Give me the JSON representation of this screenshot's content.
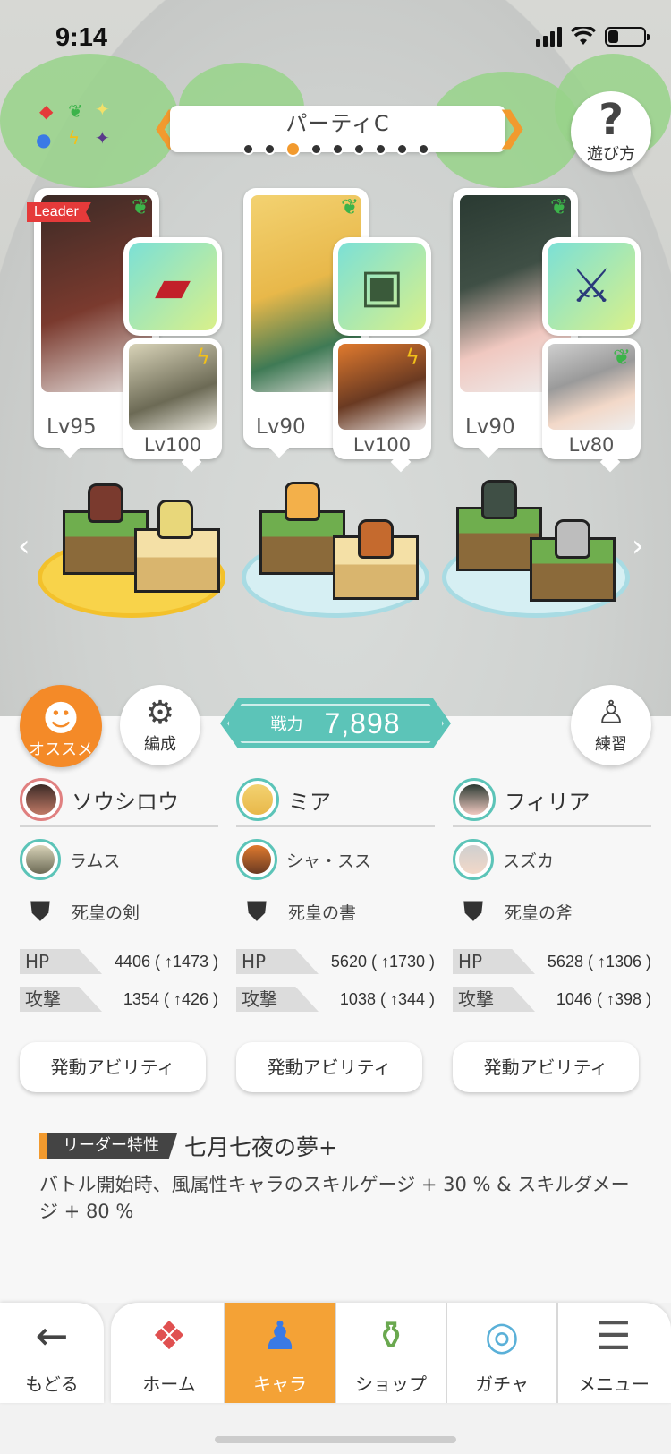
{
  "status_bar": {
    "time": "9:14"
  },
  "party": {
    "name": "パーティC",
    "page_count": 9,
    "active_index": 2
  },
  "help_button": {
    "glyph": "?",
    "label": "遊び方"
  },
  "units": [
    {
      "main_level": "Lv95",
      "leader_tag": "Leader",
      "main_element": "leaf",
      "sub_level": "Lv100",
      "sub_element": "bolt",
      "equip_icon": "red-sword-icon"
    },
    {
      "main_level": "Lv90",
      "leader_tag": "",
      "main_element": "leaf",
      "sub_level": "Lv100",
      "sub_element": "bolt",
      "equip_icon": "green-book-icon"
    },
    {
      "main_level": "Lv90",
      "leader_tag": "",
      "main_element": "leaf",
      "sub_level": "Lv80",
      "sub_element": "leaf",
      "equip_icon": "dark-axe-icon"
    }
  ],
  "actions": {
    "recommend_label": "オススメ",
    "formation_label": "編成",
    "practice_label": "練習"
  },
  "power": {
    "label": "戦力",
    "value": "7,898"
  },
  "columns": [
    {
      "name": "ソウシロウ",
      "sub": "ラムス",
      "equip": "死皇の剣",
      "hp_label": "HP",
      "hp": "4406 ( ↑1473 )",
      "atk_label": "攻撃",
      "atk": "1354 ( ↑426 )",
      "ability": "発動アビリティ"
    },
    {
      "name": "ミア",
      "sub": "シャ・スス",
      "equip": "死皇の書",
      "hp_label": "HP",
      "hp": "5620 ( ↑1730 )",
      "atk_label": "攻撃",
      "atk": "1038 ( ↑344 )",
      "ability": "発動アビリティ"
    },
    {
      "name": "フィリア",
      "sub": "スズカ",
      "equip": "死皇の斧",
      "hp_label": "HP",
      "hp": "5628 ( ↑1306 )",
      "atk_label": "攻撃",
      "atk": "1046 ( ↑398 )",
      "ability": "発動アビリティ"
    }
  ],
  "leader_skill": {
    "badge": "リーダー特性",
    "title": "七月七夜の夢+",
    "description": "バトル開始時、風属性キャラのスキルゲージ + 30 % & スキルダメージ + 80 %"
  },
  "nav": {
    "back": "もどる",
    "tabs": [
      {
        "label": "ホーム",
        "icon": "home-icon"
      },
      {
        "label": "キャラ",
        "icon": "chara-icon"
      },
      {
        "label": "ショップ",
        "icon": "shop-icon"
      },
      {
        "label": "ガチャ",
        "icon": "gacha-icon"
      },
      {
        "label": "メニュー",
        "icon": "menu-icon"
      }
    ],
    "active_tab": "キャラ"
  },
  "colors": {
    "accent": "#f29a2e",
    "teal": "#5cc4b8",
    "leader_red": "#e53a3a"
  }
}
